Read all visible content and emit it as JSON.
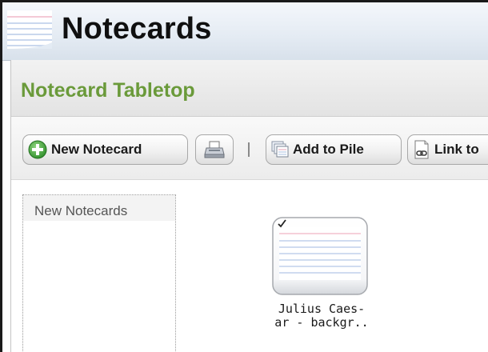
{
  "app": {
    "title": "Notecards",
    "icon": "notecard-stack-icon"
  },
  "panel": {
    "title": "Notecard Tabletop"
  },
  "toolbar": {
    "new_notecard_label": "New Notecard",
    "new_notecard_icon": "plus-circle-icon",
    "print_icon": "printer-icon",
    "add_to_pile_label": "Add to Pile",
    "add_to_pile_icon": "cards-pile-icon",
    "link_to_label": "Link to",
    "link_to_icon": "link-icon"
  },
  "piles": [
    {
      "label": "New Notecards"
    }
  ],
  "notecards": [
    {
      "title_line1": "Julius Caes-",
      "title_line2": "ar - backgr..",
      "checked": true,
      "icon": "notecard-icon"
    }
  ],
  "colors": {
    "panel_title": "#6a9a3a",
    "title_bar": "#e4ebf3",
    "plus_icon": "#3fa337"
  }
}
